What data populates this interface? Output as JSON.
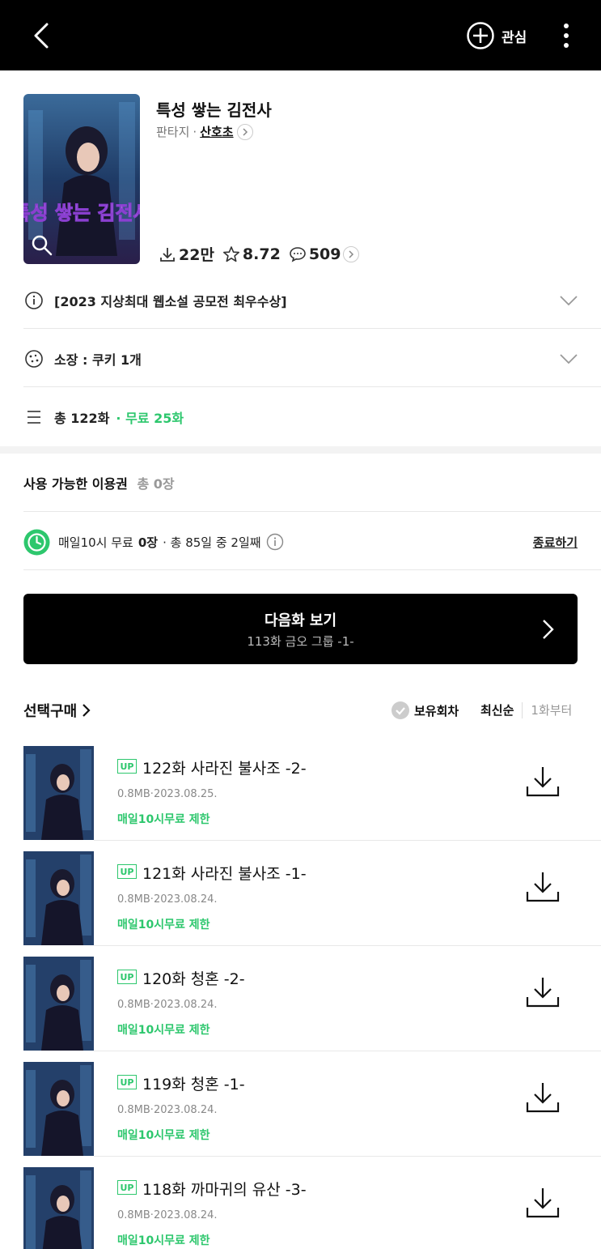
{
  "header": {
    "favorite_label": "관심",
    "icons": [
      "back-icon",
      "plus-circle-icon",
      "more-vertical-icon"
    ]
  },
  "book": {
    "cover_text": "특성 쌓는 김전사",
    "title": "특성 쌓는 김전사",
    "genre": "판타지",
    "separator": "·",
    "author": "산호초",
    "downloads": "22만",
    "rating": "8.72",
    "comments": "509"
  },
  "info_rows": {
    "award": "[2023 지상최대 웹소설 공모전 최우수상]",
    "cookie": "소장 : 쿠키 1개",
    "total_prefix": "총 122화",
    "total_free": "· 무료 25화"
  },
  "tickets": {
    "title": "사용 가능한 이용권",
    "count": "총 0장",
    "daily_prefix": "매일10시 무료",
    "daily_count": "0장",
    "daily_suffix": "· 총 85일 중 2일째",
    "end_label": "종료하기"
  },
  "next_button": {
    "label": "다음화 보기",
    "episode": "113화 금오 그룹 -1-"
  },
  "list_header": {
    "select_label": "선택구매",
    "owned_label": "보유회차",
    "sort_latest": "최신순",
    "sort_first": "1화부터"
  },
  "episodes": [
    {
      "badge": "UP",
      "title": "122화 사라진 불사조 -2-",
      "info": "0.8MB·2023.08.25.",
      "limit": "매일10시무료 제한"
    },
    {
      "badge": "UP",
      "title": "121화 사라진 불사조 -1-",
      "info": "0.8MB·2023.08.24.",
      "limit": "매일10시무료 제한"
    },
    {
      "badge": "UP",
      "title": "120화 청혼 -2-",
      "info": "0.8MB·2023.08.24.",
      "limit": "매일10시무료 제한"
    },
    {
      "badge": "UP",
      "title": "119화 청혼 -1-",
      "info": "0.8MB·2023.08.24.",
      "limit": "매일10시무료 제한"
    },
    {
      "badge": "UP",
      "title": "118화 까마귀의 유산 -3-",
      "info": "0.8MB·2023.08.24.",
      "limit": "매일10시무료 제한"
    }
  ],
  "colors": {
    "accent_green": "#2dc76d",
    "header_bg": "#000000"
  }
}
